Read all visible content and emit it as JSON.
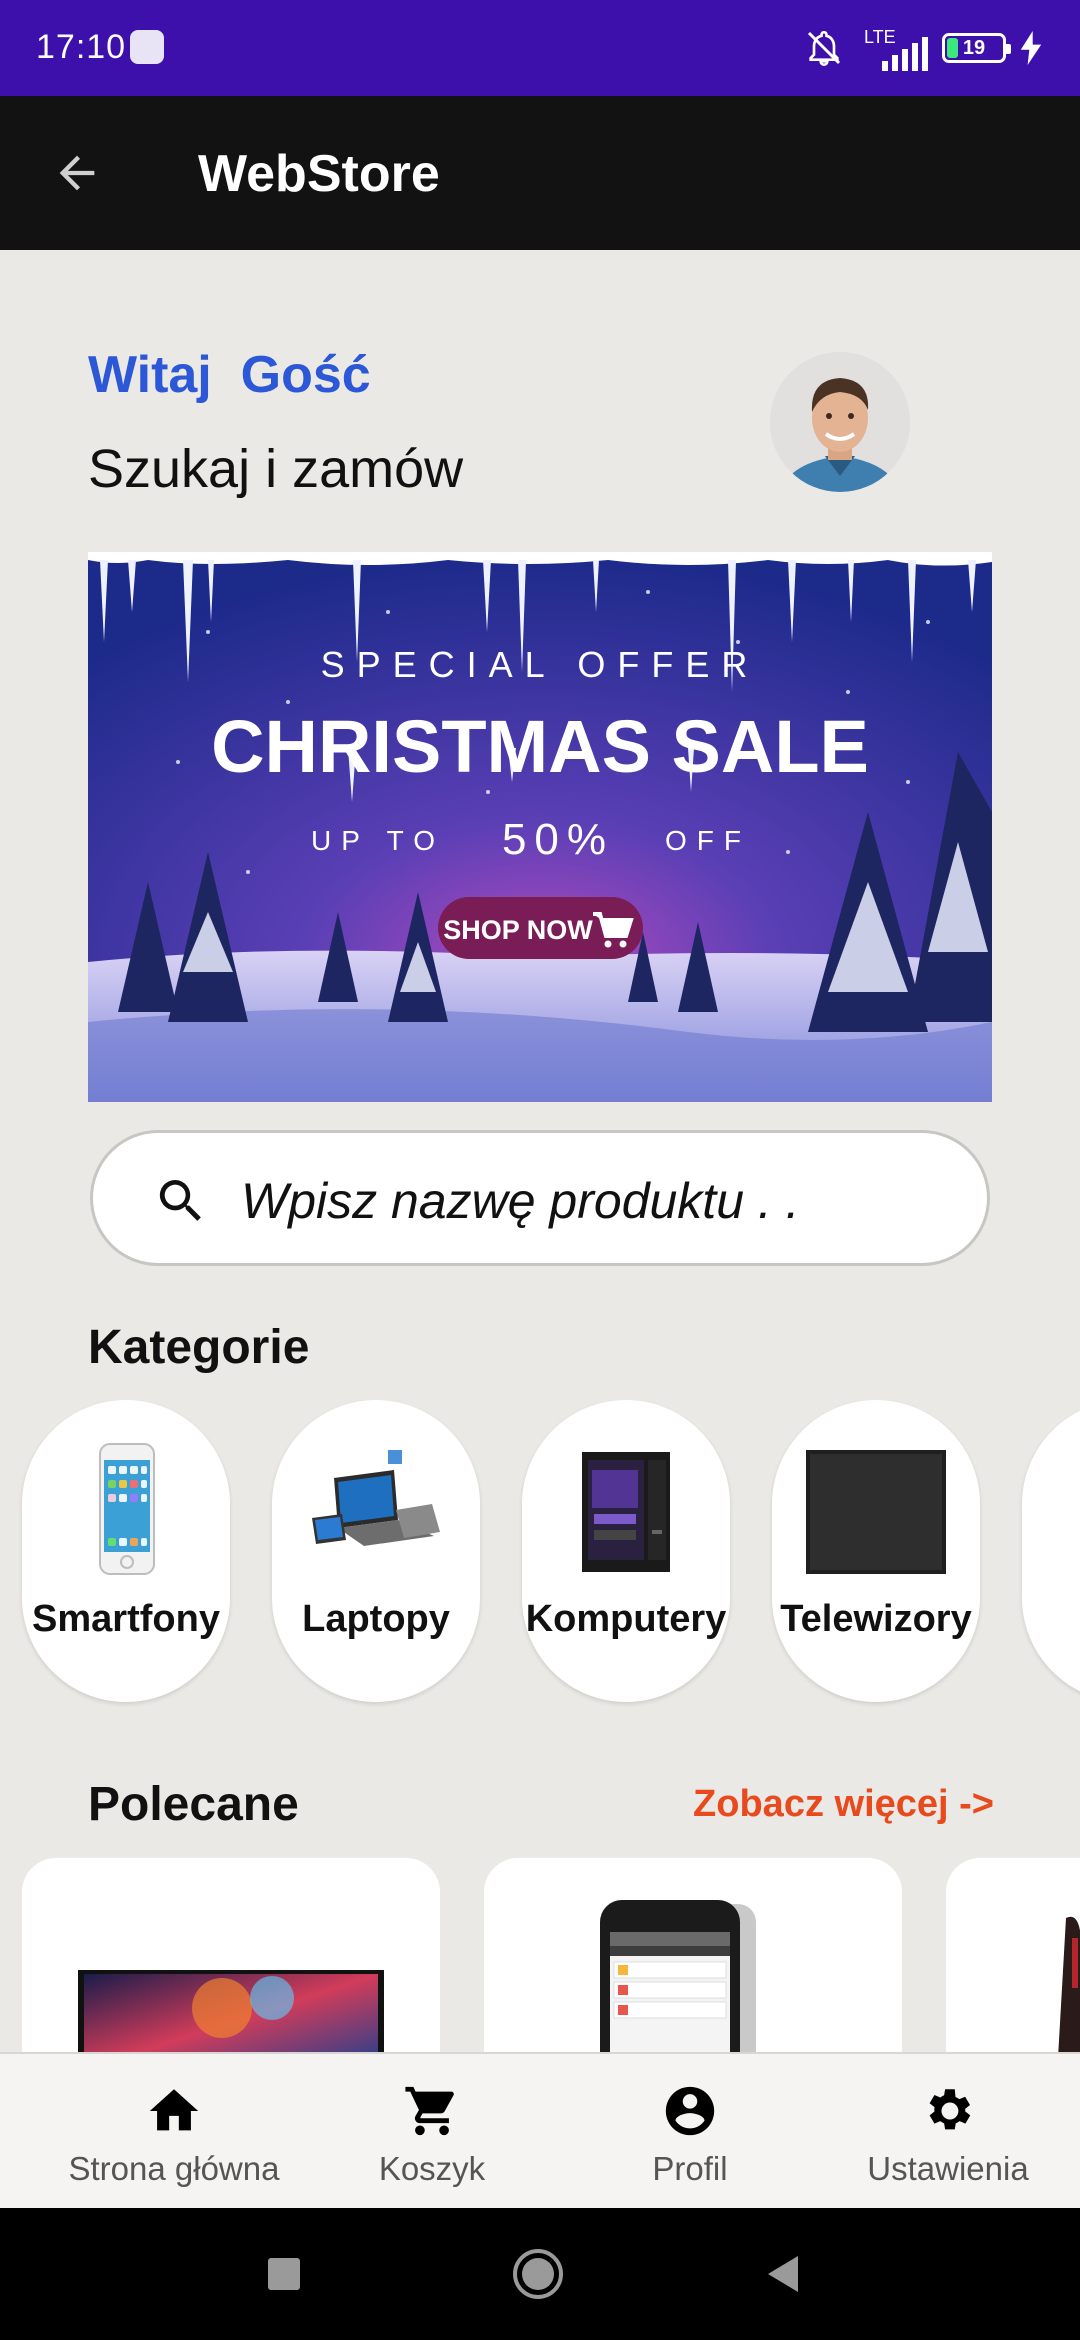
{
  "status_bar": {
    "time": "17:10",
    "network": "LTE",
    "battery": "19",
    "battery_level": 0.19,
    "icons": [
      "app-notification-icon",
      "bell-off-icon",
      "signal-icon",
      "battery-icon",
      "charging-icon"
    ]
  },
  "app_bar": {
    "title": "WebStore",
    "back_icon": "arrow-back-icon"
  },
  "greeting": {
    "word": "Witaj",
    "name": "Gość",
    "subtitle": "Szukaj i zamów"
  },
  "banner": {
    "label": "SPECIAL OFFER",
    "headline": "CHRISTMAS SALE",
    "discount_prefix": "UP TO",
    "discount_value": "50%",
    "discount_suffix": "OFF",
    "cta": "SHOP NOW"
  },
  "search": {
    "placeholder": "Wpisz nazwę produktu . .",
    "icon": "search-icon"
  },
  "categories": {
    "title": "Kategorie",
    "items": [
      {
        "label": "Smartfony",
        "icon": "smartphone-icon"
      },
      {
        "label": "Laptopy",
        "icon": "laptop-icon"
      },
      {
        "label": "Komputery",
        "icon": "desktop-computer-icon"
      },
      {
        "label": "Telewizory",
        "icon": "tv-icon"
      }
    ]
  },
  "recommended": {
    "title": "Polecane",
    "see_more": "Zobacz więcej ->"
  },
  "bottom_nav": [
    {
      "label": "Strona główna",
      "icon": "home-icon"
    },
    {
      "label": "Koszyk",
      "icon": "cart-icon"
    },
    {
      "label": "Profil",
      "icon": "account-icon"
    },
    {
      "label": "Ustawienia",
      "icon": "settings-icon"
    }
  ],
  "colors": {
    "status_bar": "#3d0fab",
    "app_bar": "#121212",
    "greeting": "#2c57d6",
    "accent": "#e8491d",
    "background": "#ebe9e5"
  }
}
